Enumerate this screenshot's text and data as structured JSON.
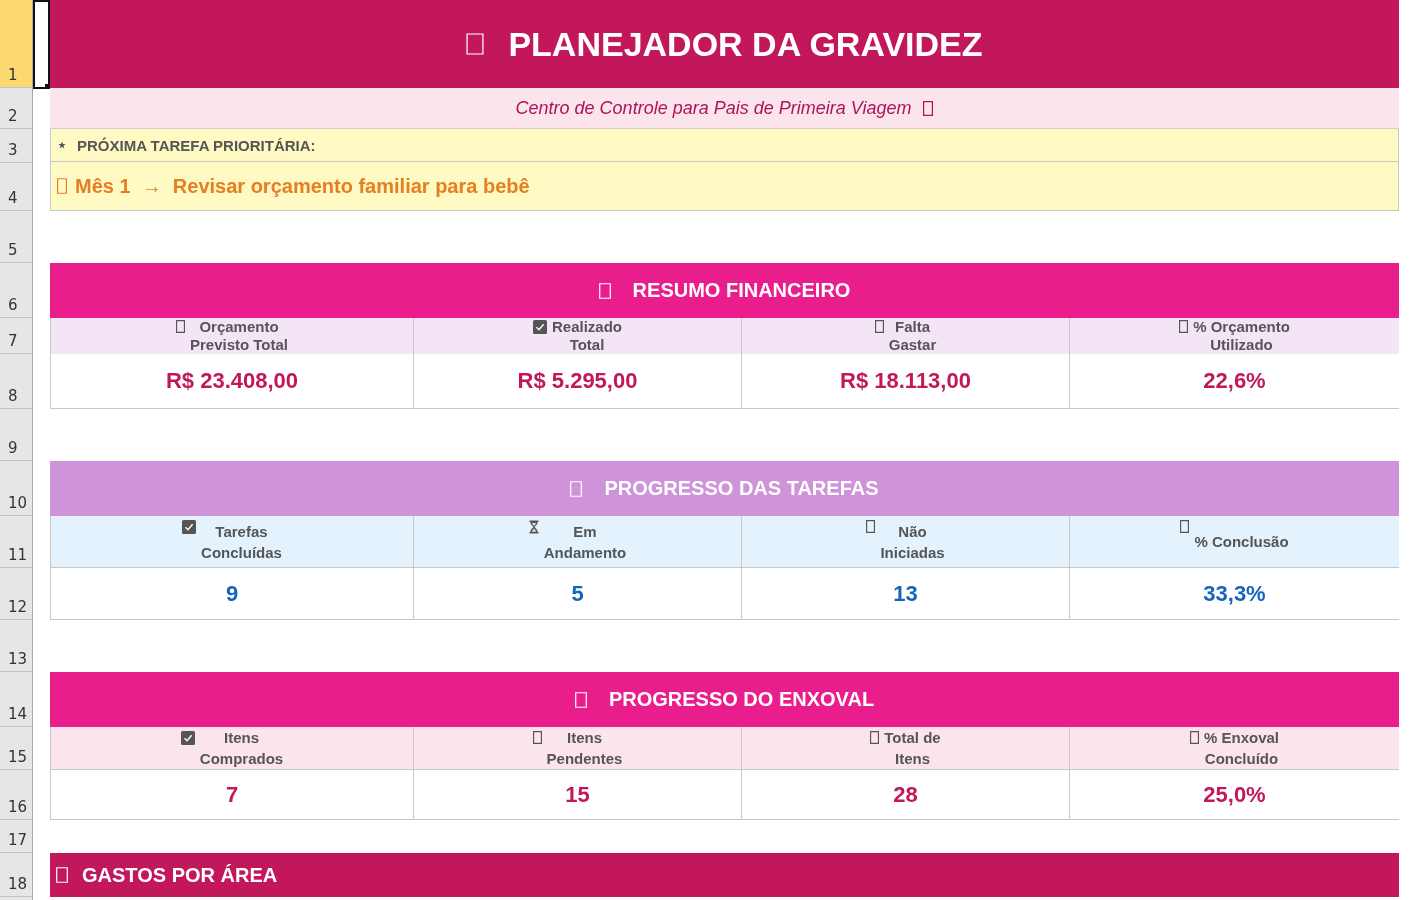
{
  "row_headers": [
    {
      "label": "1",
      "selected": true
    },
    {
      "label": "2",
      "selected": false
    },
    {
      "label": "3",
      "selected": false
    },
    {
      "label": "4",
      "selected": false
    },
    {
      "label": "5",
      "selected": false
    },
    {
      "label": "6",
      "selected": false
    },
    {
      "label": "7",
      "selected": false
    },
    {
      "label": "8",
      "selected": false
    },
    {
      "label": "9",
      "selected": false
    },
    {
      "label": "10",
      "selected": false
    },
    {
      "label": "11",
      "selected": false
    },
    {
      "label": "12",
      "selected": false
    },
    {
      "label": "13",
      "selected": false
    },
    {
      "label": "14",
      "selected": false
    },
    {
      "label": "15",
      "selected": false
    },
    {
      "label": "16",
      "selected": false
    },
    {
      "label": "17",
      "selected": false
    },
    {
      "label": "18",
      "selected": false
    }
  ],
  "banner": {
    "title": "PLANEJADOR DA GRAVIDEZ"
  },
  "subtitle": "Centro de Controle para Pais de Primeira Viagem",
  "priority": {
    "label": "PRÓXIMA TAREFA PRIORITÁRIA:",
    "task": "Mês 1  →  Revisar orçamento familiar para bebê"
  },
  "sections": [
    {
      "kind": "finance",
      "title": "RESUMO FINANCEIRO",
      "stats": [
        {
          "kind": "other",
          "label": "Orçamento\nPrevisto Total",
          "value": "R$ 23.408,00"
        },
        {
          "kind": "done",
          "label": "Realizado\nTotal",
          "value": "R$ 5.295,00"
        },
        {
          "kind": "other",
          "label": "Falta\nGastar",
          "value": "R$ 18.113,00"
        },
        {
          "kind": "other",
          "label": "% Orçamento\nUtilizado",
          "value": "22,6%"
        }
      ]
    },
    {
      "kind": "tasks",
      "title": "PROGRESSO DAS TAREFAS",
      "stats": [
        {
          "kind": "done",
          "label": "Tarefas\nConcluídas",
          "value": "9"
        },
        {
          "kind": "ongoing",
          "label": "Em\nAndamento",
          "value": "5"
        },
        {
          "kind": "other",
          "label": "Não\nIniciadas",
          "value": "13"
        },
        {
          "kind": "other",
          "label": "% Conclusão",
          "value": "33,3%"
        }
      ]
    },
    {
      "kind": "layette",
      "title": "PROGRESSO DO ENXOVAL",
      "stats": [
        {
          "kind": "done",
          "label": "Itens\nComprados",
          "value": "7"
        },
        {
          "kind": "other",
          "label": "Itens\nPendentes",
          "value": "15"
        },
        {
          "kind": "other",
          "label": "Total de\nItens",
          "value": "28"
        },
        {
          "kind": "other",
          "label": "% Enxoval\nConcluído",
          "value": "25,0%"
        }
      ]
    }
  ],
  "spending_header": {
    "title": "GASTOS POR ÁREA"
  }
}
